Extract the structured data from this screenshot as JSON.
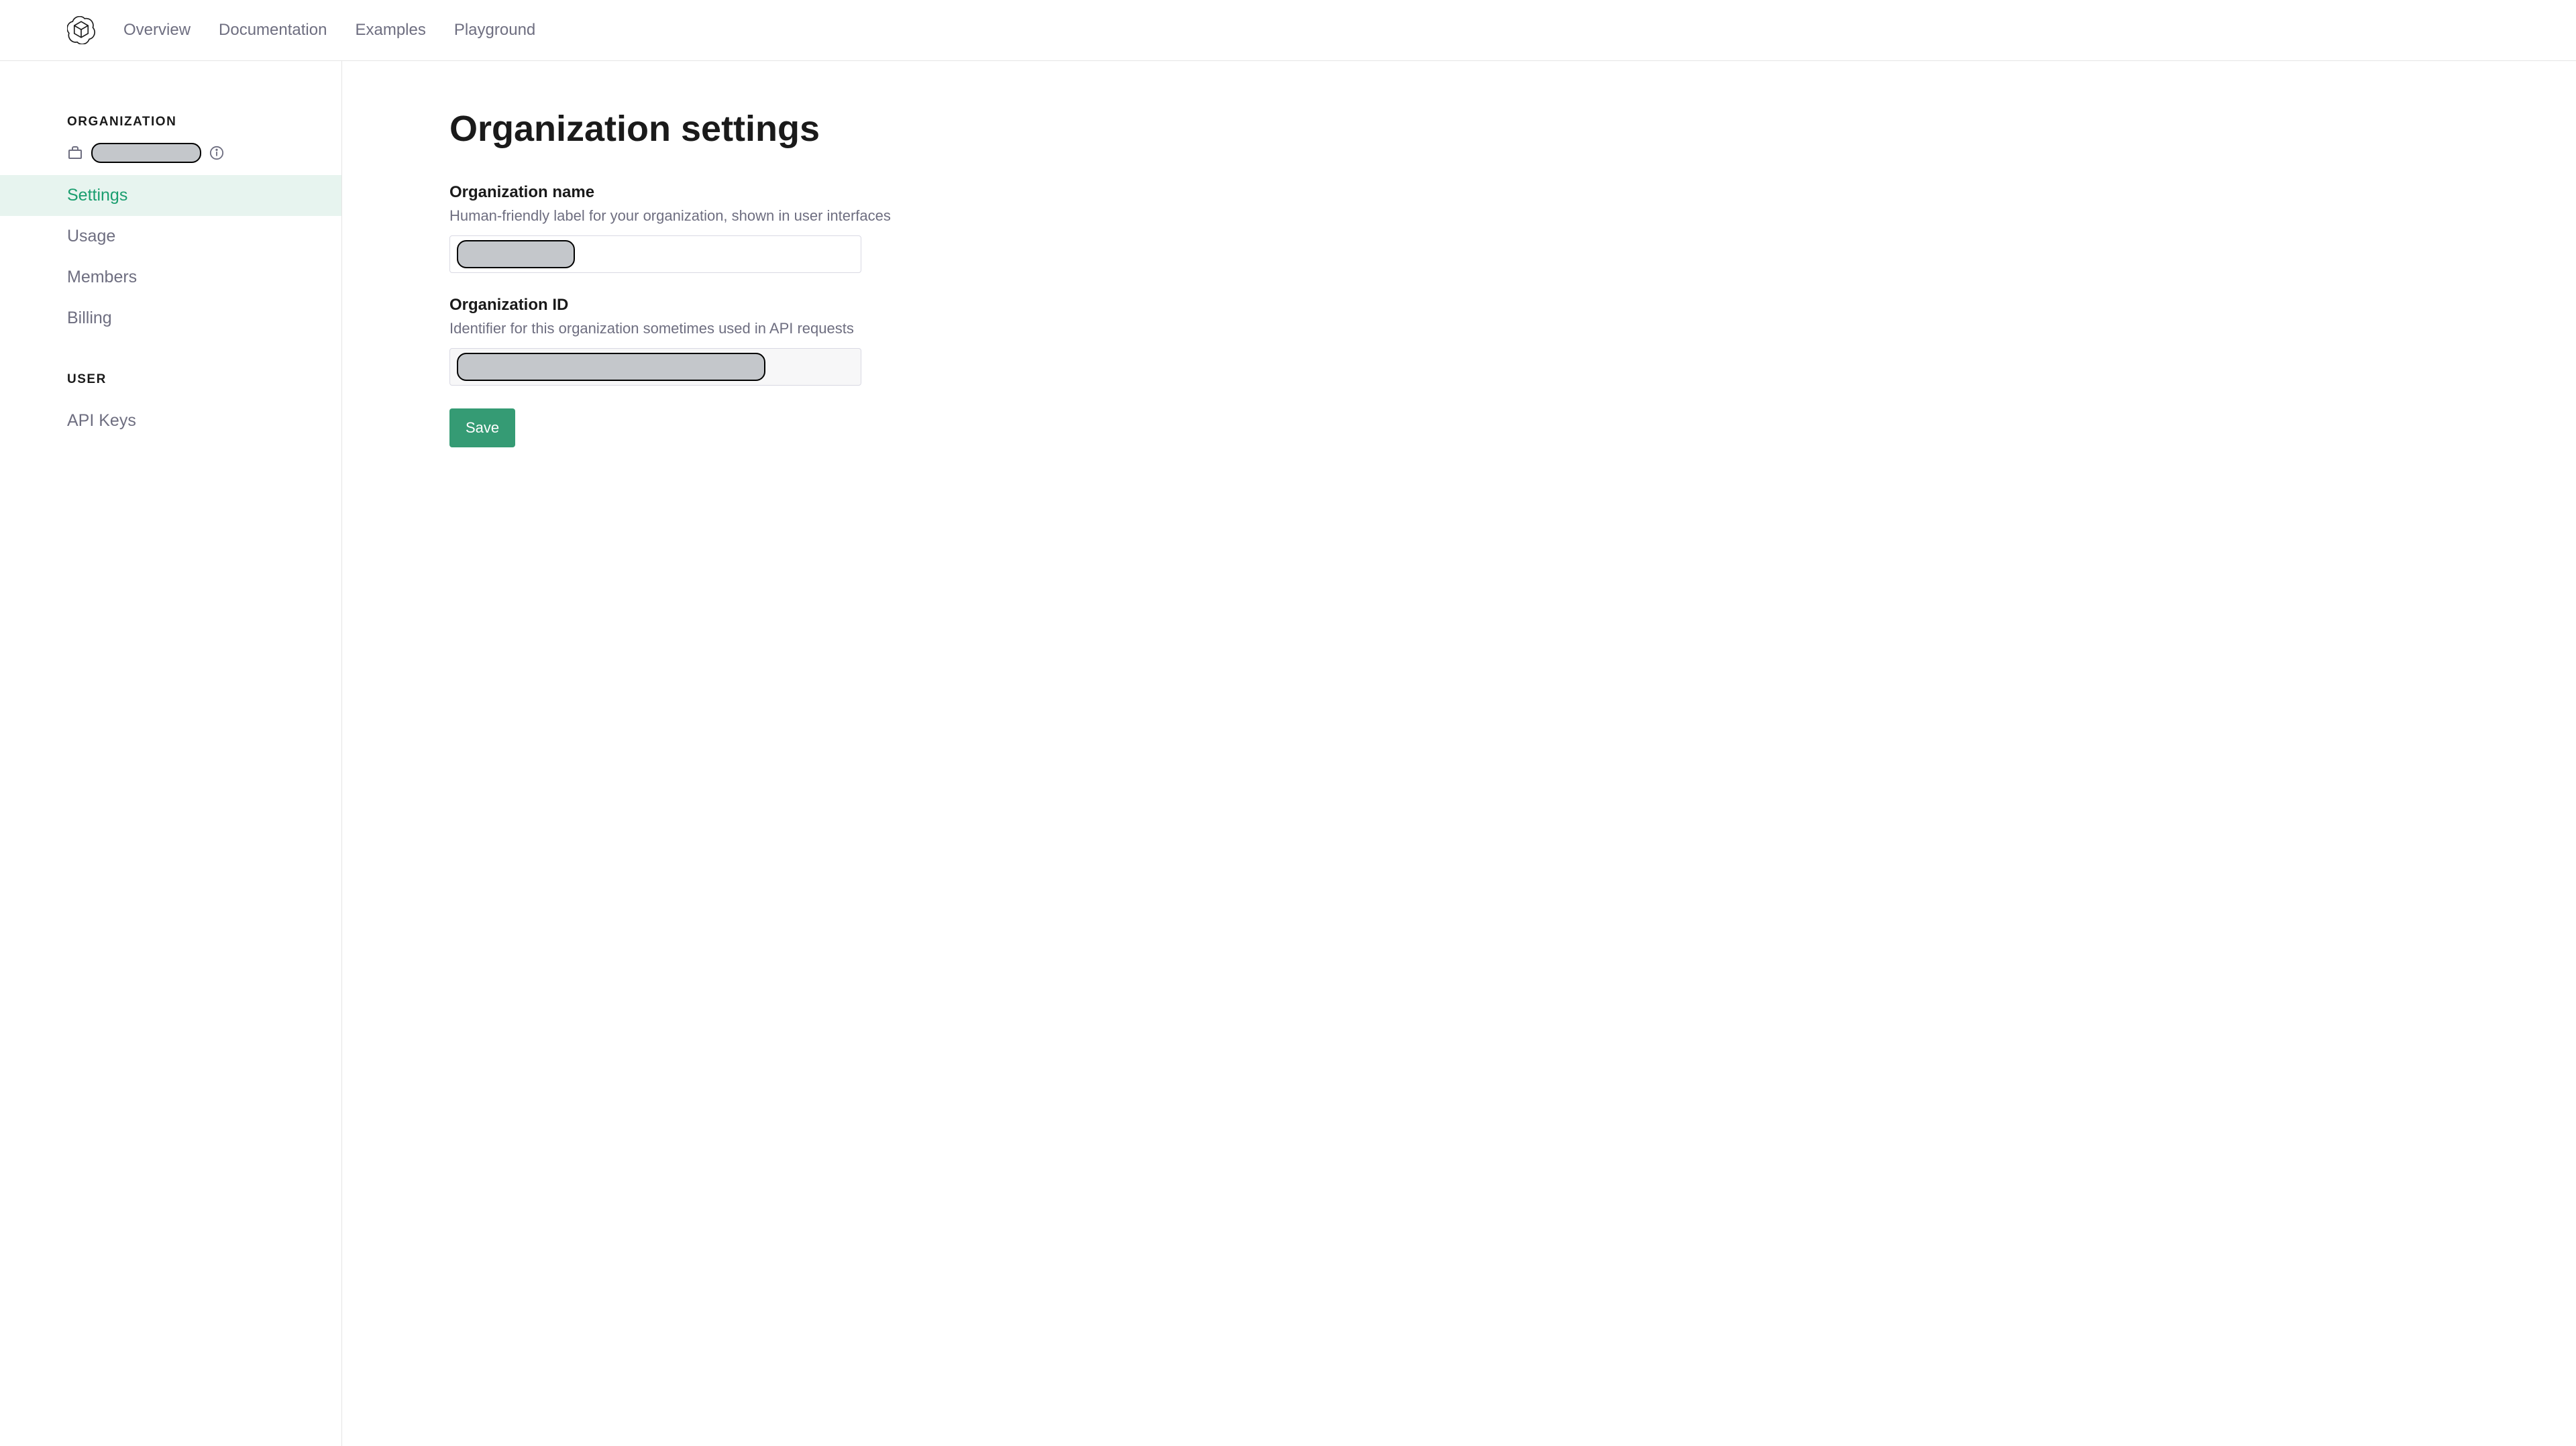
{
  "nav": {
    "links": [
      "Overview",
      "Documentation",
      "Examples",
      "Playground"
    ]
  },
  "sidebar": {
    "org_section_label": "ORGANIZATION",
    "items": [
      {
        "label": "Settings",
        "active": true
      },
      {
        "label": "Usage",
        "active": false
      },
      {
        "label": "Members",
        "active": false
      },
      {
        "label": "Billing",
        "active": false
      }
    ],
    "user_section_label": "USER",
    "user_items": [
      {
        "label": "API Keys"
      }
    ]
  },
  "main": {
    "title": "Organization settings",
    "org_name": {
      "label": "Organization name",
      "desc": "Human-friendly label for your organization, shown in user interfaces",
      "value": ""
    },
    "org_id": {
      "label": "Organization ID",
      "desc": "Identifier for this organization sometimes used in API requests",
      "value": ""
    },
    "save_label": "Save"
  }
}
